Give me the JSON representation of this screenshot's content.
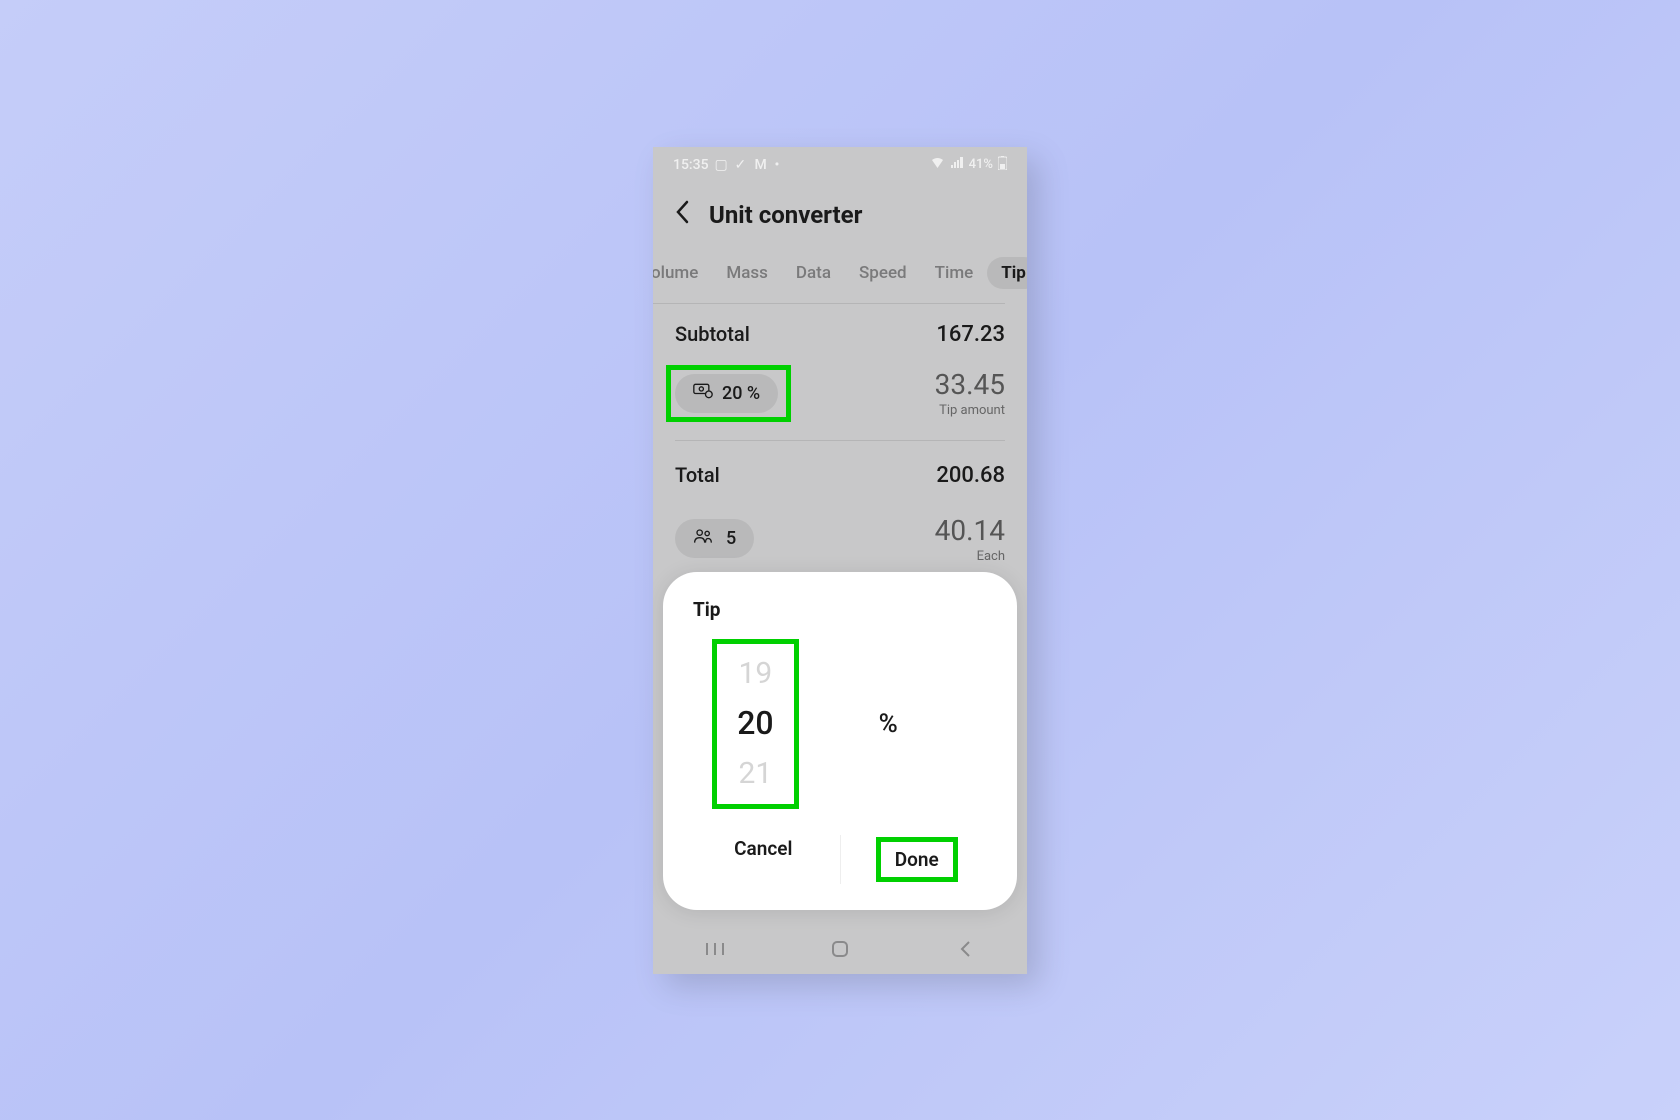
{
  "status": {
    "time": "15:35",
    "battery": "41%"
  },
  "header": {
    "title": "Unit converter"
  },
  "tabs": {
    "items": [
      "olume",
      "Mass",
      "Data",
      "Speed",
      "Time",
      "Tip"
    ],
    "active": "Tip"
  },
  "subtotal": {
    "label": "Subtotal",
    "value": "167.23"
  },
  "tip": {
    "percent_label": "20 %",
    "amount": "33.45",
    "amount_label": "Tip amount"
  },
  "total": {
    "label": "Total",
    "value": "200.68"
  },
  "people": {
    "count": "5",
    "each": "40.14",
    "each_label": "Each"
  },
  "sheet": {
    "title": "Tip",
    "prev": "19",
    "current": "20",
    "next": "21",
    "unit": "%",
    "cancel": "Cancel",
    "done": "Done"
  }
}
